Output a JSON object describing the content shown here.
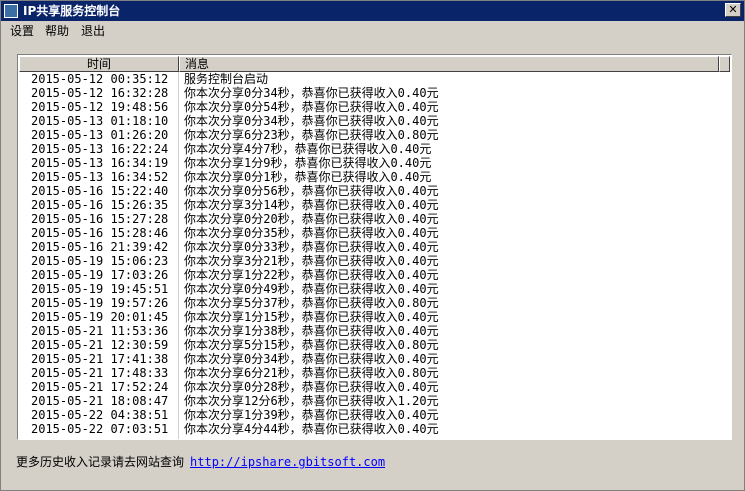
{
  "window": {
    "title": "IP共享服务控制台",
    "close_glyph": "✕"
  },
  "menu": [
    "设置",
    "帮助",
    "退出"
  ],
  "table": {
    "columns": [
      "时间",
      "消息"
    ],
    "rows": [
      [
        "2015-05-12 00:35:12",
        "服务控制台启动"
      ],
      [
        "2015-05-12 16:32:28",
        "你本次分享0分34秒，恭喜你已获得收入0.40元"
      ],
      [
        "2015-05-12 19:48:56",
        "你本次分享0分54秒，恭喜你已获得收入0.40元"
      ],
      [
        "2015-05-13 01:18:10",
        "你本次分享0分34秒，恭喜你已获得收入0.40元"
      ],
      [
        "2015-05-13 01:26:20",
        "你本次分享6分23秒，恭喜你已获得收入0.80元"
      ],
      [
        "2015-05-13 16:22:24",
        "你本次分享4分7秒，恭喜你已获得收入0.40元"
      ],
      [
        "2015-05-13 16:34:19",
        "你本次分享1分9秒，恭喜你已获得收入0.40元"
      ],
      [
        "2015-05-13 16:34:52",
        "你本次分享0分1秒，恭喜你已获得收入0.40元"
      ],
      [
        "2015-05-16 15:22:40",
        "你本次分享0分56秒，恭喜你已获得收入0.40元"
      ],
      [
        "2015-05-16 15:26:35",
        "你本次分享3分14秒，恭喜你已获得收入0.40元"
      ],
      [
        "2015-05-16 15:27:28",
        "你本次分享0分20秒，恭喜你已获得收入0.40元"
      ],
      [
        "2015-05-16 15:28:46",
        "你本次分享0分35秒，恭喜你已获得收入0.40元"
      ],
      [
        "2015-05-16 21:39:42",
        "你本次分享0分33秒，恭喜你已获得收入0.40元"
      ],
      [
        "2015-05-19 15:06:23",
        "你本次分享3分21秒，恭喜你已获得收入0.40元"
      ],
      [
        "2015-05-19 17:03:26",
        "你本次分享1分22秒，恭喜你已获得收入0.40元"
      ],
      [
        "2015-05-19 19:45:51",
        "你本次分享0分49秒，恭喜你已获得收入0.40元"
      ],
      [
        "2015-05-19 19:57:26",
        "你本次分享5分37秒，恭喜你已获得收入0.80元"
      ],
      [
        "2015-05-19 20:01:45",
        "你本次分享1分15秒，恭喜你已获得收入0.40元"
      ],
      [
        "2015-05-21 11:53:36",
        "你本次分享1分38秒，恭喜你已获得收入0.40元"
      ],
      [
        "2015-05-21 12:30:59",
        "你本次分享5分15秒，恭喜你已获得收入0.80元"
      ],
      [
        "2015-05-21 17:41:38",
        "你本次分享0分34秒，恭喜你已获得收入0.40元"
      ],
      [
        "2015-05-21 17:48:33",
        "你本次分享6分21秒，恭喜你已获得收入0.80元"
      ],
      [
        "2015-05-21 17:52:24",
        "你本次分享0分28秒，恭喜你已获得收入0.40元"
      ],
      [
        "2015-05-21 18:08:47",
        "你本次分享12分6秒，恭喜你已获得收入1.20元"
      ],
      [
        "2015-05-22 04:38:51",
        "你本次分享1分39秒，恭喜你已获得收入0.40元"
      ],
      [
        "2015-05-22 07:03:51",
        "你本次分享4分44秒，恭喜你已获得收入0.40元"
      ]
    ]
  },
  "footer": {
    "text": "更多历史收入记录请去网站查询",
    "link": "http://ipshare.gbitsoft.com"
  }
}
